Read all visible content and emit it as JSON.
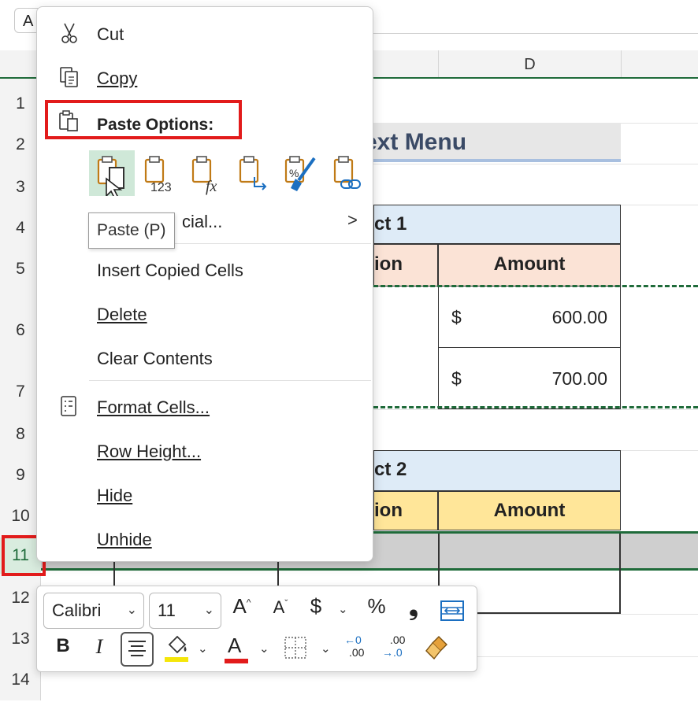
{
  "spreadsheet": {
    "name_box": "A",
    "column_header_visible": "D",
    "rows": [
      "1",
      "2",
      "3",
      "4",
      "5",
      "6",
      "7",
      "8",
      "9",
      "10",
      "11",
      "12",
      "13",
      "14"
    ],
    "active_row": "11",
    "title_fragment": "ext Menu",
    "project1_fragment": "ct 1",
    "project2_fragment": "ct 2",
    "header_fragment_1": "ion",
    "header_fragment_2": "ion",
    "amount_header": "Amount",
    "amounts": [
      {
        "currency": "$",
        "value": "600.00"
      },
      {
        "currency": "$",
        "value": "700.00"
      }
    ]
  },
  "context_menu": {
    "cut": "Cut",
    "copy": "Copy",
    "paste_options": "Paste Options:",
    "paste_special_fragment": "cial...",
    "insert_copied_cells": "Insert Copied Cells",
    "delete": "Delete",
    "clear_contents": "Clear Contents",
    "format_cells": "Format Cells...",
    "row_height": "Row Height...",
    "hide": "Hide",
    "unhide": "Unhide",
    "paste_icons": [
      "paste-icon",
      "paste-values-icon",
      "paste-formulas-icon",
      "paste-transpose-icon",
      "paste-formatting-icon",
      "paste-link-icon"
    ],
    "paste_icon_labels": [
      "123",
      "fx"
    ],
    "tooltip": "Paste (P)",
    "submenu_arrow": ">"
  },
  "mini_toolbar": {
    "font": "Calibri",
    "size": "11",
    "increase_font": "A",
    "decrease_font": "A",
    "currency": "$",
    "percent": "%",
    "comma": "❟",
    "bold": "B",
    "italic": "I",
    "font_color_letter": "A",
    "dec_increase_top": "←0",
    "dec_increase_bottom": ".00",
    "dec_decrease_top": ".00",
    "dec_decrease_bottom": "→.0"
  },
  "colors": {
    "highlight_red": "#e21b1b",
    "excel_green": "#1f6b3a",
    "project_header_blue": "#deebf7",
    "header_peach": "#fbe3d6",
    "header_yellow": "#ffe699",
    "font_color_red": "#e21b1b",
    "fill_yellow": "#f5e60a"
  }
}
